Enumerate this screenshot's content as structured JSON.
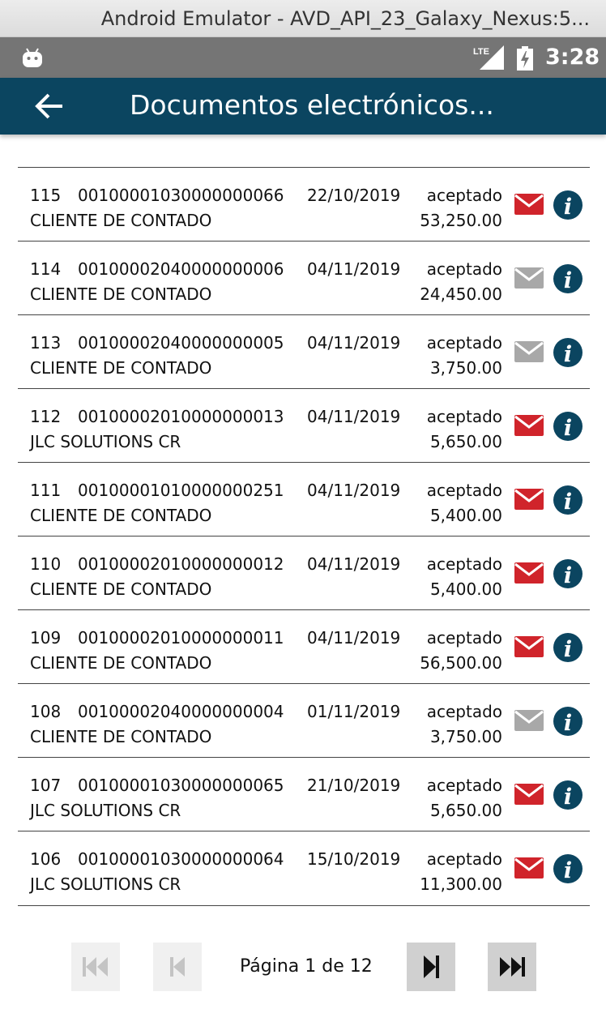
{
  "window": {
    "title": "Android Emulator - AVD_API_23_Galaxy_Nexus:5..."
  },
  "statusbar": {
    "time": "3:28",
    "network_label": "LTE",
    "icons": [
      "android-icon",
      "lte-signal-icon",
      "battery-charging-icon"
    ]
  },
  "appbar": {
    "title": "Documentos electrónicos...",
    "back_icon": "arrow-back-icon"
  },
  "colors": {
    "appbar": "#0b4560",
    "mail_active": "#d0242b",
    "mail_inactive": "#a8a8a8",
    "info": "#0b4560"
  },
  "documents": [
    {
      "number": "115",
      "doc": "00100001030000000066",
      "date": "22/10/2019",
      "status": "aceptado",
      "client": "CLIENTE DE CONTADO",
      "amount": "53,250.00",
      "mail_sent": true
    },
    {
      "number": "114",
      "doc": "00100002040000000006",
      "date": "04/11/2019",
      "status": "aceptado",
      "client": "CLIENTE DE CONTADO",
      "amount": "24,450.00",
      "mail_sent": false
    },
    {
      "number": "113",
      "doc": "00100002040000000005",
      "date": "04/11/2019",
      "status": "aceptado",
      "client": "CLIENTE DE CONTADO",
      "amount": "3,750.00",
      "mail_sent": false
    },
    {
      "number": "112",
      "doc": "00100002010000000013",
      "date": "04/11/2019",
      "status": "aceptado",
      "client": "JLC SOLUTIONS CR",
      "amount": "5,650.00",
      "mail_sent": true
    },
    {
      "number": "111",
      "doc": "00100001010000000251",
      "date": "04/11/2019",
      "status": "aceptado",
      "client": "CLIENTE DE CONTADO",
      "amount": "5,400.00",
      "mail_sent": true
    },
    {
      "number": "110",
      "doc": "00100002010000000012",
      "date": "04/11/2019",
      "status": "aceptado",
      "client": "CLIENTE DE CONTADO",
      "amount": "5,400.00",
      "mail_sent": true
    },
    {
      "number": "109",
      "doc": "00100002010000000011",
      "date": "04/11/2019",
      "status": "aceptado",
      "client": "CLIENTE DE CONTADO",
      "amount": "56,500.00",
      "mail_sent": true
    },
    {
      "number": "108",
      "doc": "00100002040000000004",
      "date": "01/11/2019",
      "status": "aceptado",
      "client": "CLIENTE DE CONTADO",
      "amount": "3,750.00",
      "mail_sent": false
    },
    {
      "number": "107",
      "doc": "00100001030000000065",
      "date": "21/10/2019",
      "status": "aceptado",
      "client": "JLC SOLUTIONS CR",
      "amount": "5,650.00",
      "mail_sent": true
    },
    {
      "number": "106",
      "doc": "00100001030000000064",
      "date": "15/10/2019",
      "status": "aceptado",
      "client": "JLC SOLUTIONS CR",
      "amount": "11,300.00",
      "mail_sent": true
    }
  ],
  "pagination": {
    "label": "Página 1 de 12",
    "current_page": 1,
    "total_pages": 12,
    "buttons": [
      {
        "name": "first-page-button",
        "icon": "skip-first-icon",
        "enabled": false
      },
      {
        "name": "previous-page-button",
        "icon": "skip-previous-icon",
        "enabled": false
      },
      {
        "name": "next-page-button",
        "icon": "skip-next-icon",
        "enabled": true
      },
      {
        "name": "last-page-button",
        "icon": "skip-last-icon",
        "enabled": true
      }
    ]
  }
}
